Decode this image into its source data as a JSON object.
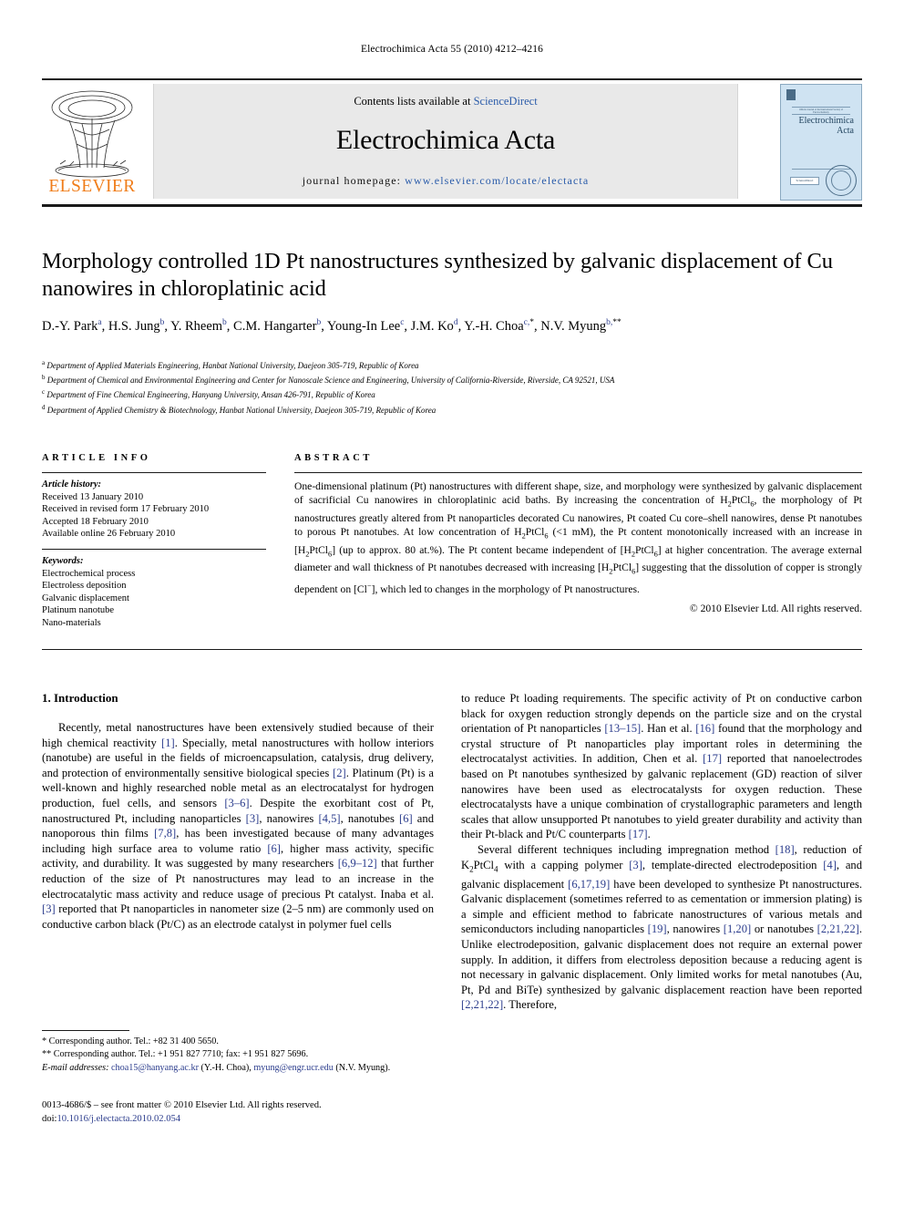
{
  "running_head": "Electrochimica Acta 55 (2010) 4212–4216",
  "masthead": {
    "publisher_name": "ELSEVIER",
    "contents_prefix": "Contents lists available at ",
    "sciencedirect": "ScienceDirect",
    "journal_title": "Electrochimica Acta",
    "homepage_label": "journal homepage:",
    "homepage_url": "www.elsevier.com/locate/electacta",
    "cover": {
      "journal_line1": "Electrochimica",
      "journal_line2": "Acta",
      "badge": "ScienceDirect",
      "society_mark": "ISE"
    },
    "accent_orange": "#F07D1A",
    "accent_link": "#2B5CAA"
  },
  "article": {
    "title": "Morphology controlled 1D Pt nanostructures synthesized by galvanic displacement of Cu nanowires in chloroplatinic acid",
    "authors": [
      {
        "name": "D.-Y. Park",
        "marks": "a"
      },
      {
        "name": "H.S. Jung",
        "marks": "b"
      },
      {
        "name": "Y. Rheem",
        "marks": "b"
      },
      {
        "name": "C.M. Hangarter",
        "marks": "b"
      },
      {
        "name": "Young-In Lee",
        "marks": "c"
      },
      {
        "name": "J.M. Ko",
        "marks": "d"
      },
      {
        "name": "Y.-H. Choa",
        "marks": "c,*"
      },
      {
        "name": "N.V. Myung",
        "marks": "b,**"
      }
    ],
    "affiliations": [
      {
        "mark": "a",
        "text": "Department of Applied Materials Engineering, Hanbat National University, Daejeon 305-719, Republic of Korea"
      },
      {
        "mark": "b",
        "text": "Department of Chemical and Environmental Engineering and Center for Nanoscale Science and Engineering, University of California-Riverside, Riverside, CA 92521, USA"
      },
      {
        "mark": "c",
        "text": "Department of Fine Chemical Engineering, Hanyang University, Ansan 426-791, Republic of Korea"
      },
      {
        "mark": "d",
        "text": "Department of Applied Chemistry & Biotechnology, Hanbat National University, Daejeon 305-719, Republic of Korea"
      }
    ]
  },
  "info": {
    "heading": "ARTICLE INFO",
    "history_label": "Article history:",
    "history": [
      "Received 13 January 2010",
      "Received in revised form 17 February 2010",
      "Accepted 18 February 2010",
      "Available online 26 February 2010"
    ],
    "keywords_label": "Keywords:",
    "keywords": [
      "Electrochemical process",
      "Electroless deposition",
      "Galvanic displacement",
      "Platinum nanotube",
      "Nano-materials"
    ]
  },
  "abstract": {
    "heading": "ABSTRACT",
    "text_part1": "One-dimensional platinum (Pt) nanostructures with different shape, size, and morphology were synthesized by galvanic displacement of sacrificial Cu nanowires in chloroplatinic acid baths. By increasing the concentration of H",
    "text_part2": ", the morphology of Pt nanostructures greatly altered from Pt nanoparticles decorated Cu nanowires, Pt coated Cu core–shell nanowires, dense Pt nanotubes to porous Pt nanotubes. At low concentration of H",
    "text_part3": " (<1 mM), the Pt content monotonically increased with an increase in [H",
    "text_part4": "] (up to approx. 80 at.%). The Pt content became independent of [H",
    "text_part5": "] at higher concentration. The average external diameter and wall thickness of Pt nanotubes decreased with increasing [H",
    "text_part6": "] suggesting that the dissolution of copper is strongly dependent on [Cl",
    "text_part7": "], which led to changes in the morphology of Pt nanostructures.",
    "copyright": "© 2010 Elsevier Ltd. All rights reserved."
  },
  "body": {
    "section_number_title": "1. Introduction",
    "left": {
      "p1_a": "Recently, metal nanostructures have been extensively studied because of their high chemical reactivity ",
      "r1": "[1]",
      "p1_b": ". Specially, metal nanostructures with hollow interiors (nanotube) are useful in the fields of microencapsulation, catalysis, drug delivery, and protection of environmentally sensitive biological species ",
      "r2": "[2]",
      "p1_c": ". Platinum (Pt) is a well-known and highly researched noble metal as an electrocatalyst for hydrogen production, fuel cells, and sensors ",
      "r3": "[3–6]",
      "p1_d": ". Despite the exorbitant cost of Pt, nanostructured Pt, including nanoparticles ",
      "r4": "[3]",
      "p1_e": ", nanowires ",
      "r5": "[4,5]",
      "p1_f": ", nanotubes ",
      "r6": "[6]",
      "p1_g": " and nanoporous thin films ",
      "r7": "[7,8]",
      "p1_h": ", has been investigated because of many advantages including high surface area to volume ratio ",
      "r8": "[6]",
      "p1_i": ", higher mass activity, specific activity, and durability. It was suggested by many researchers ",
      "r9": "[6,9–12]",
      "p1_j": " that further reduction of the size of Pt nanostructures may lead to an increase in the electrocatalytic mass activity and reduce usage of precious Pt catalyst. Inaba et al. ",
      "r10": "[3]",
      "p1_k": " reported that Pt nanoparticles in nanometer size (2–5 nm) are commonly used on conductive carbon black (Pt/C) as an electrode catalyst in polymer fuel cells"
    },
    "right": {
      "p1_a": "to reduce Pt loading requirements. The specific activity of Pt on conductive carbon black for oxygen reduction strongly depends on the particle size and on the crystal orientation of Pt nanoparticles ",
      "r1": "[13–15]",
      "p1_b": ". Han et al. ",
      "r2": "[16]",
      "p1_c": " found that the morphology and crystal structure of Pt nanoparticles play important roles in determining the electrocatalyst activities. In addition, Chen et al. ",
      "r3": "[17]",
      "p1_d": " reported that nanoelectrodes based on Pt nanotubes synthesized by galvanic replacement (GD) reaction of silver nanowires have been used as electrocatalysts for oxygen reduction. These electrocatalysts have a unique combination of crystallographic parameters and length scales that allow unsupported Pt nanotubes to yield greater durability and activity than their Pt-black and Pt/C counterparts ",
      "r4": "[17]",
      "p1_e": ".",
      "p2_a": "Several different techniques including impregnation method ",
      "r5": "[18]",
      "p2_b": ", reduction of K",
      "p2_c": "PtCl",
      "p2_d": " with a capping polymer ",
      "r6": "[3]",
      "p2_e": ", template-directed electrodeposition ",
      "r7": "[4]",
      "p2_f": ", and galvanic displacement ",
      "r8": "[6,17,19]",
      "p2_g": " have been developed to synthesize Pt nanostructures. Galvanic displacement (sometimes referred to as cementation or immersion plating) is a simple and efficient method to fabricate nanostructures of various metals and semiconductors including nanoparticles ",
      "r9": "[19]",
      "p2_h": ", nanowires ",
      "r10": "[1,20]",
      "p2_i": " or nanotubes ",
      "r11": "[2,21,22]",
      "p2_j": ". Unlike electrodeposition, galvanic displacement does not require an external power supply. In addition, it differs from electroless deposition because a reducing agent is not necessary in galvanic displacement. Only limited works for metal nanotubes (Au, Pt, Pd and BiTe) synthesized by galvanic displacement reaction have been reported ",
      "r12": "[2,21,22]",
      "p2_k": ". Therefore,"
    }
  },
  "footnotes": {
    "fn1": "* Corresponding author. Tel.: +82 31 400 5650.",
    "fn2": "** Corresponding author. Tel.: +1 951 827 7710; fax: +1 951 827 5696.",
    "email_label": "E-mail addresses:",
    "email1": "choa15@hanyang.ac.kr",
    "email1_owner": "(Y.-H. Choa),",
    "email2": "myung@engr.ucr.edu",
    "email2_owner": "(N.V. Myung)."
  },
  "imprint": {
    "line1": "0013-4686/$ – see front matter © 2010 Elsevier Ltd. All rights reserved.",
    "doi_label": "doi:",
    "doi_value": "10.1016/j.electacta.2010.02.054"
  }
}
